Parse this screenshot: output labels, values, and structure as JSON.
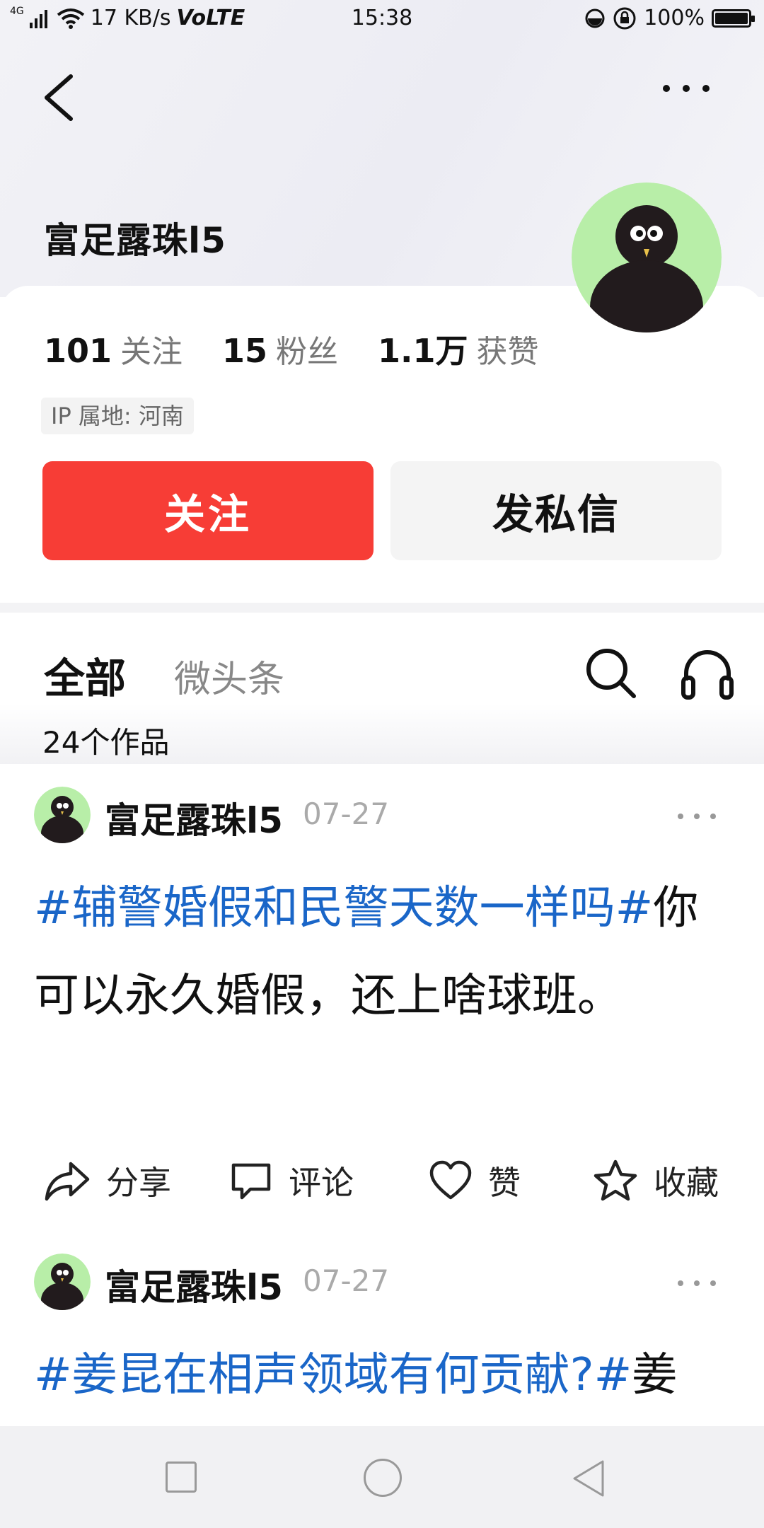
{
  "status_bar": {
    "network_type": "4G",
    "speed": "17 KB/s",
    "volte": "VoLTE",
    "time": "15:38",
    "battery_text": "100%"
  },
  "header": {
    "back_icon": "chevron-left-icon",
    "more_icon": "more-horizontal-icon"
  },
  "profile": {
    "name": "富足露珠l5",
    "avatar": "black-bird-avatar",
    "stats": [
      {
        "value": "101",
        "label": "关注"
      },
      {
        "value": "15",
        "label": "粉丝"
      },
      {
        "value": "1.1万",
        "label": "获赞"
      }
    ],
    "ip_location": "IP 属地: 河南",
    "follow_label": "关注",
    "message_label": "发私信"
  },
  "tabs": {
    "items": [
      {
        "label": "全部",
        "active": true
      },
      {
        "label": "微头条",
        "active": false
      }
    ],
    "works_count": "24个作品"
  },
  "posts": [
    {
      "author": "富足露珠l5",
      "date": "07-27",
      "hashtag": "#辅警婚假和民警天数一样吗#",
      "text": "你可以永久婚假，还上啥球班。",
      "actions": {
        "share": "分享",
        "comment": "评论",
        "like": "赞",
        "collect": "收藏"
      }
    },
    {
      "author": "富足露珠l5",
      "date": "07-27",
      "hashtag": "#姜昆在相声领域有何贡献?#",
      "text": "姜"
    }
  ],
  "colors": {
    "follow_button": "#f73d36",
    "hashtag": "#1a66c8",
    "avatar_bg": "#b8eea8"
  }
}
